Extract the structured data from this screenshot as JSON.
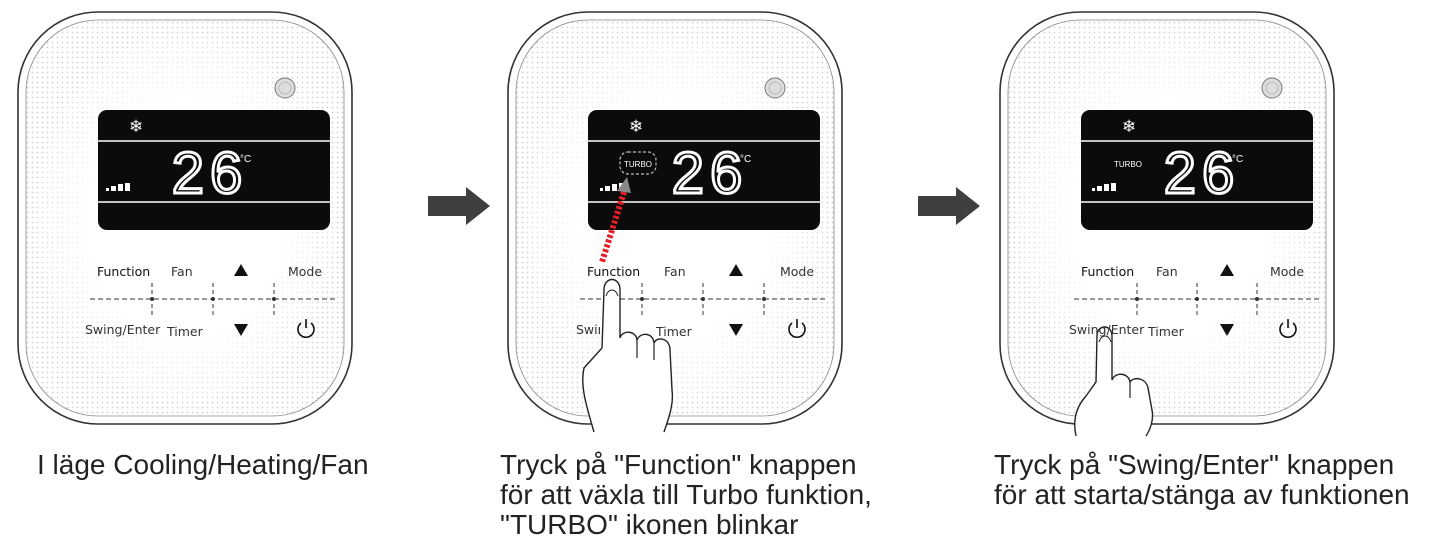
{
  "steps": [
    {
      "caption": "I läge Cooling/Heating/Fan",
      "display": {
        "temperature": "26",
        "unit": "°C",
        "turbo_text": "",
        "turbo_state": "off"
      },
      "buttons": {
        "function": "Function",
        "fan": "Fan",
        "mode": "Mode",
        "swing_enter": "Swing/Enter",
        "timer": "Timer"
      },
      "icons": [
        "snowflake-icon",
        "fan-speed-icon",
        "up-arrow-icon",
        "down-arrow-icon",
        "power-icon",
        "sensor-icon"
      ],
      "hand": "none"
    },
    {
      "caption": "Tryck på \"Function\" knappen\nför att växla till Turbo funktion,\n\"TURBO\" ikonen blinkar",
      "display": {
        "temperature": "26",
        "unit": "°C",
        "turbo_text": "TURBO",
        "turbo_state": "blinking"
      },
      "buttons": {
        "function": "Function",
        "fan": "Fan",
        "mode": "Mode",
        "swing_enter": "Swing/Enter",
        "timer": "Timer"
      },
      "icons": [
        "snowflake-icon",
        "fan-speed-icon",
        "up-arrow-icon",
        "down-arrow-icon",
        "power-icon",
        "sensor-icon"
      ],
      "hand": "pressing-function"
    },
    {
      "caption": "Tryck på  \"Swing/Enter\" knappen\nför att starta/stänga av funktionen",
      "display": {
        "temperature": "26",
        "unit": "°C",
        "turbo_text": "TURBO",
        "turbo_state": "on"
      },
      "buttons": {
        "function": "Function",
        "fan": "Fan",
        "mode": "Mode",
        "swing_enter": "Swing/Enter",
        "timer": "Timer"
      },
      "icons": [
        "snowflake-icon",
        "fan-speed-icon",
        "up-arrow-icon",
        "down-arrow-icon",
        "power-icon",
        "sensor-icon"
      ],
      "hand": "pressing-swing-enter"
    }
  ],
  "colors": {
    "lcd": "#0b0b0b",
    "lcd_text": "#ffffff",
    "highlight": "#e31e24",
    "arrow": "#3f3f3f"
  }
}
